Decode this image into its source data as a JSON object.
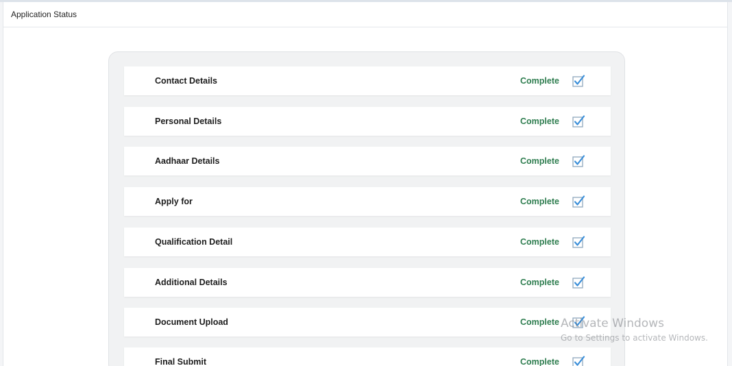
{
  "header": {
    "title": "Application Status"
  },
  "colors": {
    "status_complete": "#2e7d4f",
    "checkbox_blue": "#3b8fd9"
  },
  "steps": [
    {
      "label": "Contact Details",
      "status": "Complete",
      "checked": true,
      "icon": "checked-checkbox-icon"
    },
    {
      "label": "Personal Details",
      "status": "Complete",
      "checked": true,
      "icon": "checked-checkbox-icon"
    },
    {
      "label": "Aadhaar Details",
      "status": "Complete",
      "checked": true,
      "icon": "checked-checkbox-icon"
    },
    {
      "label": "Apply for",
      "status": "Complete",
      "checked": true,
      "icon": "checked-checkbox-icon"
    },
    {
      "label": "Qualification Detail",
      "status": "Complete",
      "checked": true,
      "icon": "checked-checkbox-icon"
    },
    {
      "label": "Additional Details",
      "status": "Complete",
      "checked": true,
      "icon": "checked-checkbox-icon"
    },
    {
      "label": "Document Upload",
      "status": "Complete",
      "checked": true,
      "icon": "checked-checkbox-icon"
    },
    {
      "label": "Final Submit",
      "status": "Complete",
      "checked": true,
      "icon": "checked-checkbox-icon"
    }
  ],
  "watermark": {
    "title": "Activate Windows",
    "subtitle": "Go to Settings to activate Windows."
  }
}
